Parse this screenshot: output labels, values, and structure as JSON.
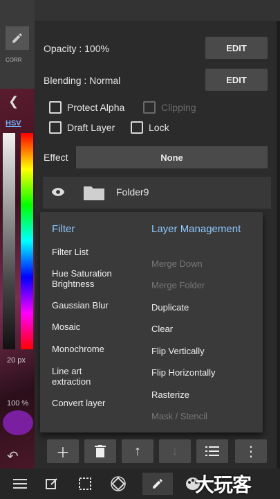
{
  "properties": {
    "opacity_label": "Opacity : 100%",
    "blending_label": "Blending : Normal",
    "edit_label": "EDIT",
    "protect_alpha": "Protect Alpha",
    "clipping": "Clipping",
    "draft_layer": "Draft Layer",
    "lock": "Lock",
    "effect_label": "Effect",
    "effect_value": "None"
  },
  "left_tools": {
    "corr_label": "CORR",
    "color_mode": "HSV",
    "brush_size": "20 px",
    "brush_opacity": "100 %"
  },
  "layers": [
    {
      "name": "Folder9"
    }
  ],
  "popup": {
    "filter_title": "Filter",
    "filter_items": [
      "Filter List",
      "Hue Saturation Brightness",
      "Gaussian Blur",
      "Mosaic",
      "Monochrome",
      "Line art extraction",
      "Convert layer"
    ],
    "layer_title": "Layer Management",
    "layer_items": [
      "Merge Down",
      "Merge Folder",
      "Duplicate",
      "Clear",
      "Flip Vertically",
      "Flip Horizontally",
      "Rasterize",
      "Mask / Stencil"
    ],
    "layer_items_disabled": [
      true,
      true,
      false,
      false,
      false,
      false,
      false,
      true
    ]
  },
  "layer_toolbar": [
    "add-icon",
    "trash-icon",
    "arrow-up-icon",
    "arrow-down-icon",
    "list-icon",
    "more-vert-icon"
  ],
  "bottom_bar": [
    "menu-icon",
    "edit-icon",
    "select-icon",
    "rotate-icon",
    "pen-icon",
    "palette-icon"
  ],
  "watermark": "大玩客",
  "colors": {
    "accent_blue": "#8ec9ff",
    "panel_bg": "#2b2b2b",
    "button_bg": "#4a4a4a",
    "popup_bg": "#3a3a3a"
  }
}
